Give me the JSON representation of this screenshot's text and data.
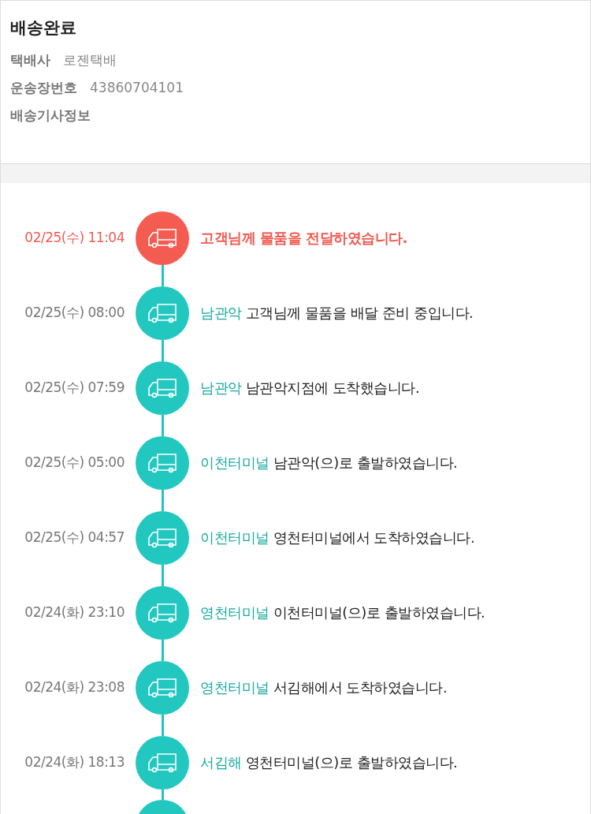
{
  "header": {
    "status": "배송완료",
    "fields": [
      {
        "label": "택배사",
        "value": "로젠택배"
      },
      {
        "label": "운송장번호",
        "value": "43860704101"
      },
      {
        "label": "배송기사정보"
      }
    ]
  },
  "timeline": [
    {
      "kind": "current",
      "date": "02/25(수) 11:04",
      "message": "고객님께 물품을 전달하였습니다."
    },
    {
      "kind": "normal",
      "date": "02/25(수) 08:00",
      "location": "남관악",
      "message": "고객님께 물품을 배달 준비 중입니다."
    },
    {
      "kind": "normal",
      "date": "02/25(수) 07:59",
      "location": "남관악",
      "message": "남관악지점에 도착했습니다."
    },
    {
      "kind": "normal",
      "date": "02/25(수) 05:00",
      "location": "이천터미널",
      "message": "남관악(으)로 출발하였습니다."
    },
    {
      "kind": "normal",
      "date": "02/25(수) 04:57",
      "location": "이천터미널",
      "message": "영천터미널에서 도착하였습니다."
    },
    {
      "kind": "normal",
      "date": "02/24(화) 23:10",
      "location": "영천터미널",
      "message": "이천터미널(으)로 출발하였습니다."
    },
    {
      "kind": "normal",
      "date": "02/24(화) 23:08",
      "location": "영천터미널",
      "message": "서김해에서 도착하였습니다."
    },
    {
      "kind": "normal",
      "date": "02/24(화) 18:13",
      "location": "서김해",
      "message": "영천터미널(으)로 출발하였습니다."
    }
  ]
}
